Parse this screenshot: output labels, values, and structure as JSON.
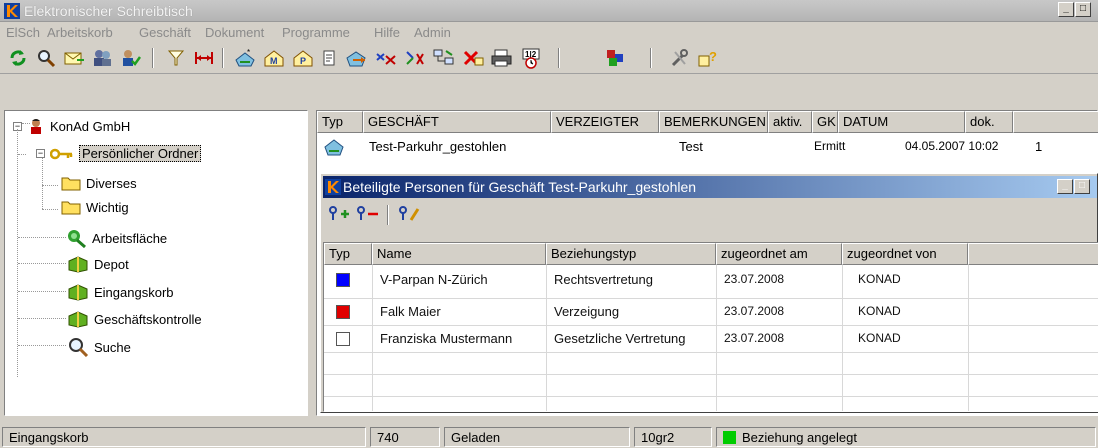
{
  "window": {
    "title": "Elektronischer Schreibtisch",
    "min_label": "_",
    "max_label": "□"
  },
  "menu": [
    "ElSch",
    "Arbeitskorb",
    "Geschäft",
    "Dokument",
    "Programme",
    "Hilfe",
    "Admin"
  ],
  "toolbar_icons": [
    "refresh-icon",
    "search-icon",
    "mail-icon",
    "people-icon",
    "user-check-icon",
    "filter-icon",
    "resize-width-icon",
    "new-case-icon",
    "case-m-icon",
    "case-p-icon",
    "document-icon",
    "forward-icon",
    "transfer-icon",
    "reassign-icon",
    "network-icon",
    "delete-icon",
    "print-icon",
    "calendar-icon",
    "cubes-icon",
    "tools-icon",
    "help-icon"
  ],
  "tree": {
    "root": "KonAd GmbH",
    "items": [
      "Persönlicher Ordner",
      "Diverses",
      "Wichtig",
      "Arbeitsfläche",
      "Depot",
      "Eingangskorb",
      "Geschäftskontrolle",
      "Suche"
    ]
  },
  "cases": {
    "columns": [
      "Typ",
      "GESCHÄFT",
      "VERZEIGTER",
      "BEMERKUNGEN",
      "aktiv.",
      "GK",
      "DATUM",
      "dok."
    ],
    "rows": [
      {
        "name": "Test-Parkuhr_gestohlen",
        "bemerkungen": "Test",
        "aktiv": "Ermitt",
        "datum": "04.05.2007 10:02",
        "dok": "1"
      }
    ]
  },
  "persons_window": {
    "title": "Beteiligte Personen für Geschäft Test-Parkuhr_gestohlen",
    "columns": [
      "Typ",
      "Name",
      "Beziehungstyp",
      "zugeordnet am",
      "zugeordnet von"
    ],
    "rows": [
      {
        "color": "#0000ff",
        "name": "V-Parpan N-Zürich",
        "beziehung": "Rechtsvertretung",
        "am": "23.07.2008",
        "von": "KONAD"
      },
      {
        "color": "#e00000",
        "name": "Falk Maier",
        "beziehung": "Verzeigung",
        "am": "23.07.2008",
        "von": "KONAD"
      },
      {
        "color": "#ffffff",
        "name": "Franziska Mustermann",
        "beziehung": "Gesetzliche Vertretung",
        "am": "23.07.2008",
        "von": "KONAD"
      }
    ]
  },
  "status": {
    "location": "Eingangskorb",
    "count": "740",
    "state": "Geladen",
    "version": "10gr2",
    "message": "Beziehung angelegt",
    "indicator_color": "#00cc00"
  }
}
